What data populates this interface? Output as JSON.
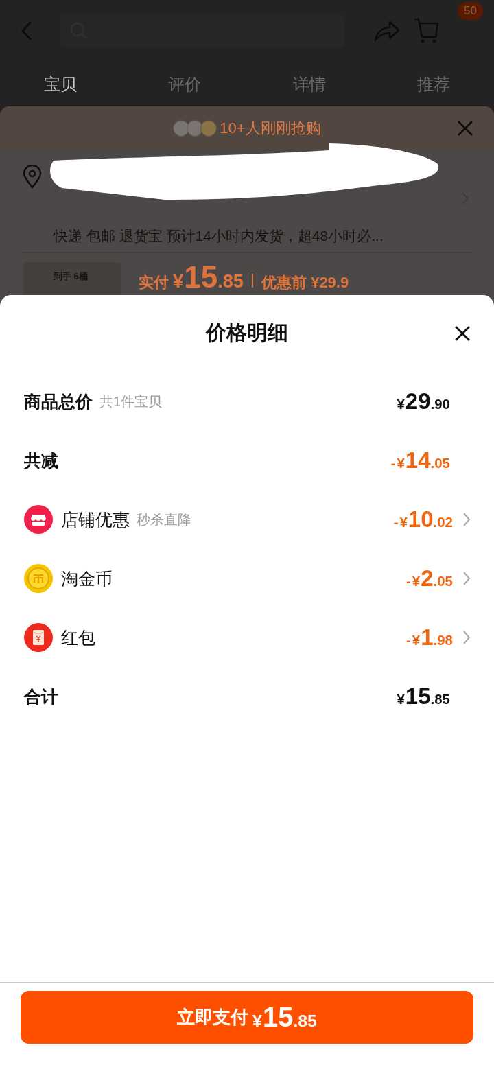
{
  "top_bar": {
    "cart_badge": "50"
  },
  "tabs": [
    {
      "label": "宝贝",
      "selected": true
    },
    {
      "label": "评价",
      "selected": false
    },
    {
      "label": "详情",
      "selected": false
    },
    {
      "label": "推荐",
      "selected": false
    }
  ],
  "order_sheet": {
    "social_proof": "10+人刚刚抢购",
    "shipping": "快递 包邮 退货宝 预计14小时内发货，超48小时必...",
    "product_tag": "到手 6桶",
    "paid_label": "实付",
    "paid_price": {
      "currency": "¥",
      "integer": "15",
      "decimal": ".85"
    },
    "before_label": "优惠前 ¥29.9"
  },
  "price_detail": {
    "title": "价格明细",
    "rows": [
      {
        "kind": "summary",
        "label": "商品总价",
        "note": "共1件宝贝",
        "negative": false,
        "price": {
          "currency": "¥",
          "integer": "29",
          "decimal": ".90"
        }
      },
      {
        "kind": "summary",
        "label": "共减",
        "negative": true,
        "price": {
          "sign": "-",
          "currency": "¥",
          "integer": "14",
          "decimal": ".05"
        }
      },
      {
        "kind": "detail",
        "label": "店铺优惠",
        "note": "秒杀直降",
        "negative": true,
        "price": {
          "sign": "-",
          "currency": "¥",
          "integer": "10",
          "decimal": ".02"
        }
      },
      {
        "kind": "detail",
        "label": "淘金币",
        "negative": true,
        "price": {
          "sign": "-",
          "currency": "¥",
          "integer": "2",
          "decimal": ".05"
        }
      },
      {
        "kind": "detail",
        "label": "红包",
        "negative": true,
        "price": {
          "sign": "-",
          "currency": "¥",
          "integer": "1",
          "decimal": ".98"
        }
      },
      {
        "kind": "summary",
        "label": "合计",
        "negative": false,
        "price": {
          "currency": "¥",
          "integer": "15",
          "decimal": ".85"
        }
      }
    ],
    "pay_button": {
      "label": "立即支付",
      "price": {
        "currency": "¥",
        "integer": "15",
        "decimal": ".85"
      }
    }
  }
}
